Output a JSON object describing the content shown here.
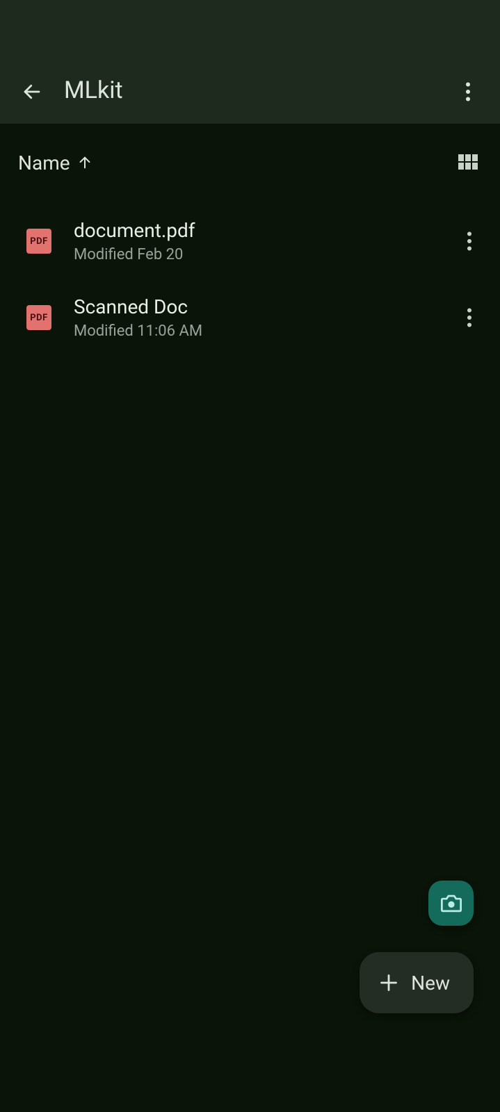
{
  "header": {
    "title": "MLkit"
  },
  "sort": {
    "label": "Name"
  },
  "files": [
    {
      "icon_label": "PDF",
      "name": "document.pdf",
      "modified": "Modified Feb 20"
    },
    {
      "icon_label": "PDF",
      "name": "Scanned Doc",
      "modified": "Modified 11:06 AM"
    }
  ],
  "fab": {
    "new_label": "New"
  }
}
